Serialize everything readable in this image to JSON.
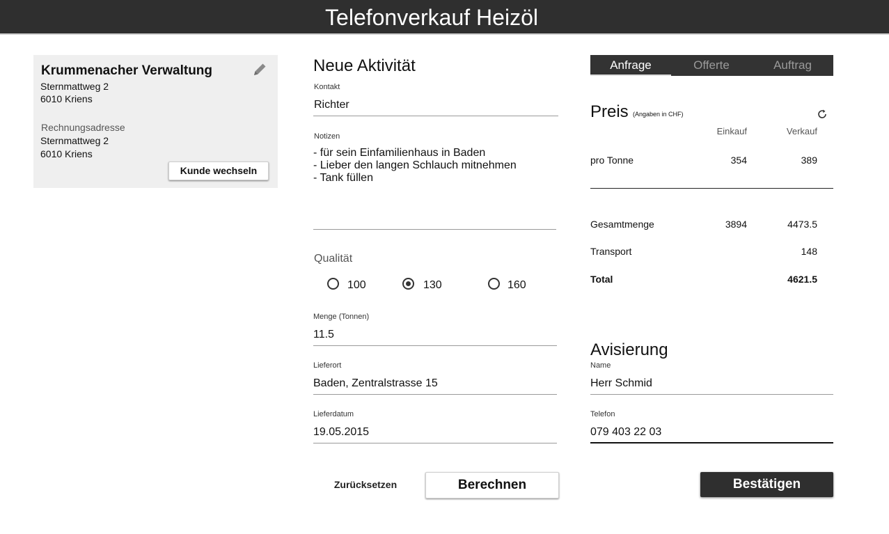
{
  "header": {
    "title": "Telefonverkauf Heizöl"
  },
  "customer": {
    "name": "Krummenacher Verwaltung",
    "edit_icon": "pencil-icon",
    "street": "Sternmattweg 2",
    "city": "6010 Kriens",
    "billing_label": "Rechnungsadresse",
    "billing_street": "Sternmattweg 2",
    "billing_city": "6010 Kriens",
    "change_button": "Kunde wechseln"
  },
  "form": {
    "title": "Neue Aktivität",
    "contact_label": "Kontakt",
    "contact_value": "Richter",
    "notes_label": "Notizen",
    "notes_value": "- für sein Einfamilienhaus in Baden\n- Lieber den langen Schlauch mitnehmen\n- Tank füllen",
    "quality_label": "Qualität",
    "quality_options": [
      "100",
      "130",
      "160"
    ],
    "quality_selected": "130",
    "amount_label": "Menge (Tonnen)",
    "amount_value": "11.5",
    "location_label": "Lieferort",
    "location_value": "Baden, Zentralstrasse 15",
    "date_label": "Lieferdatum",
    "date_value": "19.05.2015",
    "reset_button": "Zurücksetzen",
    "calculate_button": "Berechnen"
  },
  "tabs": {
    "items": [
      "Anfrage",
      "Offerte",
      "Auftrag"
    ],
    "active": "Anfrage"
  },
  "price": {
    "title": "Preis",
    "note": "(Angaben in CHF)",
    "refresh_icon": "refresh-icon",
    "col_purchase": "Einkauf",
    "col_sale": "Verkauf",
    "per_ton_label": "pro Tonne",
    "per_ton_purchase": "354",
    "per_ton_sale": "389",
    "total_amount_label": "Gesamtmenge",
    "total_amount_purchase": "3894",
    "total_amount_sale": "4473.5",
    "transport_label": "Transport",
    "transport_sale": "148",
    "total_label": "Total",
    "total_sale": "4621.5"
  },
  "notice": {
    "title": "Avisierung",
    "name_label": "Name",
    "name_value": "Herr Schmid",
    "phone_label": "Telefon",
    "phone_value": "079 403 22 03",
    "confirm_button": "Bestätigen"
  },
  "colors": {
    "header_bg": "#2f2f2f",
    "card_bg": "#efefef",
    "dark_button": "#2f2f2f"
  }
}
